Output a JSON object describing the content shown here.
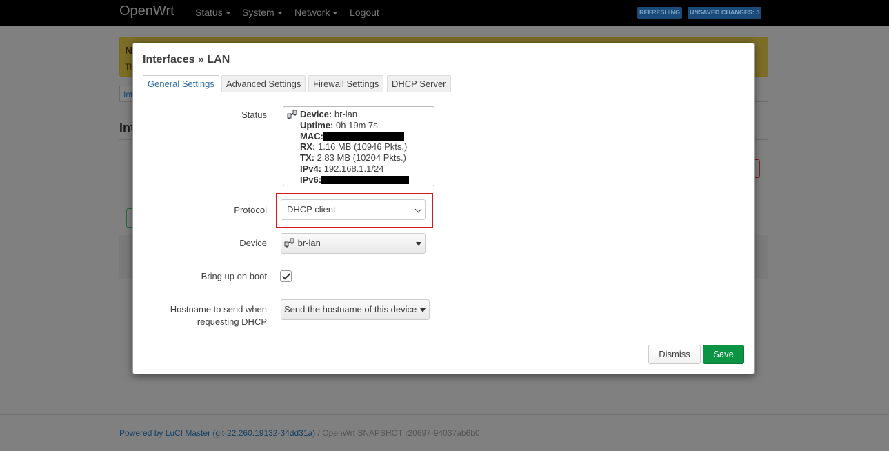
{
  "navbar": {
    "brand": "OpenWrt",
    "menu": [
      {
        "label": "Status",
        "has_caret": true
      },
      {
        "label": "System",
        "has_caret": true
      },
      {
        "label": "Network",
        "has_caret": true
      },
      {
        "label": "Logout",
        "has_caret": false
      }
    ],
    "badges": {
      "refreshing": "REFRESHING",
      "unsaved": "UNSAVED CHANGES: 5"
    }
  },
  "background": {
    "alert_title": "N",
    "alert_text": "Th",
    "tab_partial": "Int",
    "heading_partial": "Int"
  },
  "modal": {
    "title": "Interfaces » LAN",
    "tabs": [
      "General Settings",
      "Advanced Settings",
      "Firewall Settings",
      "DHCP Server"
    ],
    "active_tab": "General Settings",
    "status": {
      "label": "Status",
      "device_label": "Device:",
      "device_value": "br-lan",
      "uptime_label": "Uptime:",
      "uptime_value": "0h 19m 7s",
      "mac_label": "MAC:",
      "rx_label": "RX:",
      "rx_value": "1.16 MB (10946 Pkts.)",
      "tx_label": "TX:",
      "tx_value": "2.83 MB (10204 Pkts.)",
      "ipv4_label": "IPv4:",
      "ipv4_value": "192.168.1.1/24",
      "ipv6_label": "IPv6:"
    },
    "protocol": {
      "label": "Protocol",
      "value": "DHCP client"
    },
    "device": {
      "label": "Device",
      "value": "br-lan"
    },
    "boot": {
      "label": "Bring up on boot",
      "checked": true
    },
    "hostname": {
      "label_line1": "Hostname to send when",
      "label_line2": "requesting DHCP",
      "value": "Send the hostname of this device"
    },
    "buttons": {
      "dismiss": "Dismiss",
      "save": "Save"
    }
  },
  "footer": {
    "link_text": "Powered by LuCI Master (git-22.260.19132-34dd31a)",
    "rest_text": " / OpenWrt SNAPSHOT r20697-94037ab6b0"
  },
  "colors": {
    "highlight": "#d7191c",
    "save": "#0b9444",
    "active_tab": "#2b6ca3"
  }
}
